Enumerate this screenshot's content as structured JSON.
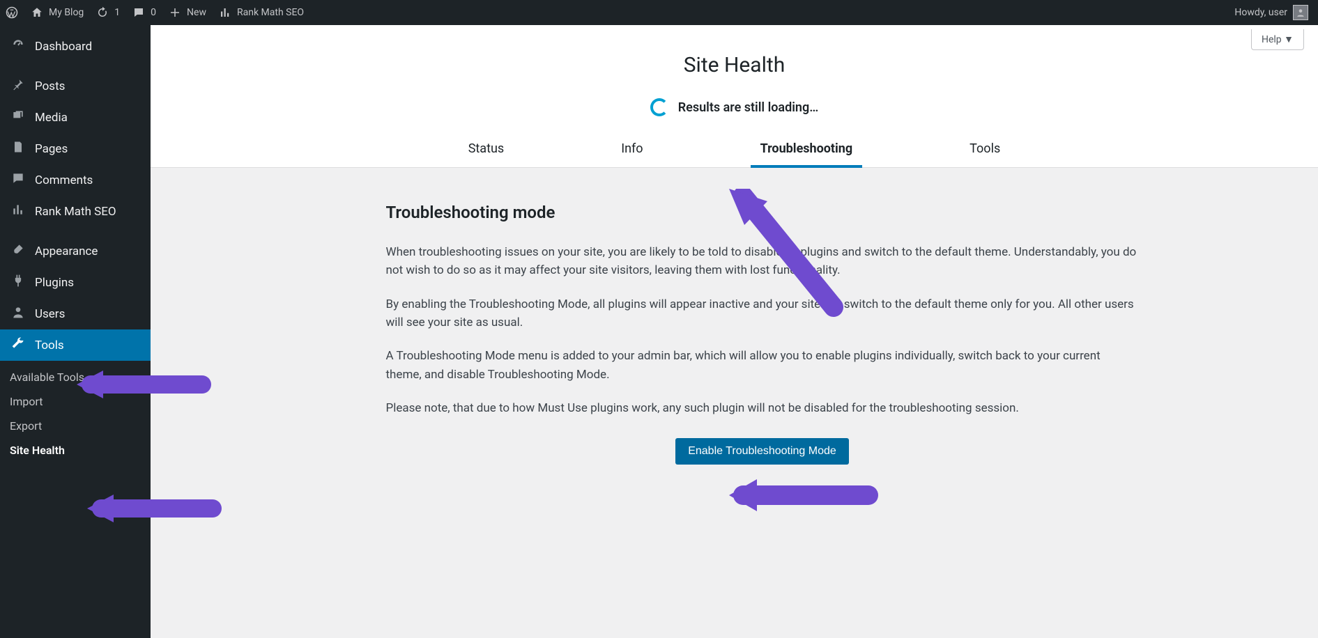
{
  "adminbar": {
    "site_name": "My Blog",
    "updates_count": "1",
    "comments_count": "0",
    "new_label": "New",
    "rankmath_label": "Rank Math SEO",
    "howdy": "Howdy, user"
  },
  "sidebar": {
    "items": [
      {
        "label": "Dashboard",
        "icon": "dashboard"
      },
      {
        "label": "Posts",
        "icon": "pin"
      },
      {
        "label": "Media",
        "icon": "media"
      },
      {
        "label": "Pages",
        "icon": "page"
      },
      {
        "label": "Comments",
        "icon": "comment"
      },
      {
        "label": "Rank Math SEO",
        "icon": "chart"
      },
      {
        "label": "Appearance",
        "icon": "brush"
      },
      {
        "label": "Plugins",
        "icon": "plug"
      },
      {
        "label": "Users",
        "icon": "user"
      },
      {
        "label": "Tools",
        "icon": "tools"
      }
    ],
    "submenu": [
      "Available Tools",
      "Import",
      "Export",
      "Site Health"
    ]
  },
  "help_label": "Help",
  "page": {
    "title": "Site Health",
    "loading": "Results are still loading…",
    "tabs": [
      "Status",
      "Info",
      "Troubleshooting",
      "Tools"
    ],
    "section_title": "Troubleshooting mode",
    "p1": "When troubleshooting issues on your site, you are likely to be told to disable all plugins and switch to the default theme. Understandably, you do not wish to do so as it may affect your site visitors, leaving them with lost functionality.",
    "p2": "By enabling the Troubleshooting Mode, all plugins will appear inactive and your site will switch to the default theme only for you. All other users will see your site as usual.",
    "p3": "A Troubleshooting Mode menu is added to your admin bar, which will allow you to enable plugins individually, switch back to your current theme, and disable Troubleshooting Mode.",
    "p4": "Please note, that due to how Must Use plugins work, any such plugin will not be disabled for the troubleshooting session.",
    "button": "Enable Troubleshooting Mode"
  }
}
